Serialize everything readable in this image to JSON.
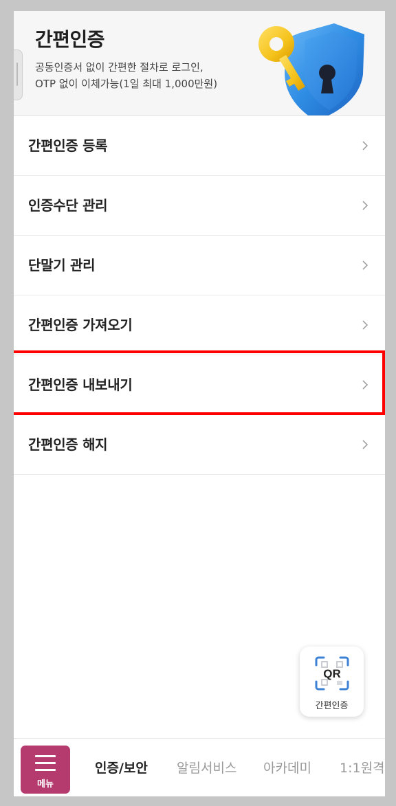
{
  "header": {
    "title": "간편인증",
    "description_lines": [
      "공동인증서 없이 간편한 절차로 로그인,",
      "OTP 없이 이체가능(1일 최대 1,000만원)"
    ],
    "illustration": "key-shield-icon"
  },
  "menu": {
    "items": [
      {
        "label": "간편인증 등록"
      },
      {
        "label": "인증수단 관리"
      },
      {
        "label": "단말기 관리"
      },
      {
        "label": "간편인증 가져오기"
      },
      {
        "label": "간편인증 내보내기",
        "highlighted": true
      },
      {
        "label": "간편인증 해지"
      }
    ]
  },
  "qr_button": {
    "icon_text": "QR",
    "label": "간편인증"
  },
  "bottom_nav": {
    "menu_label": "메뉴",
    "tabs": [
      {
        "label": "인증/보안",
        "active": true
      },
      {
        "label": "알림서비스",
        "active": false
      },
      {
        "label": "아카데미",
        "active": false
      },
      {
        "label": "1:1원격",
        "active": false
      }
    ]
  },
  "colors": {
    "brand": "#b53a6e",
    "highlight": "#ff0000",
    "qr_accent": "#3b82d6",
    "shield": "#2f8de4",
    "key": "#f5c21b"
  }
}
